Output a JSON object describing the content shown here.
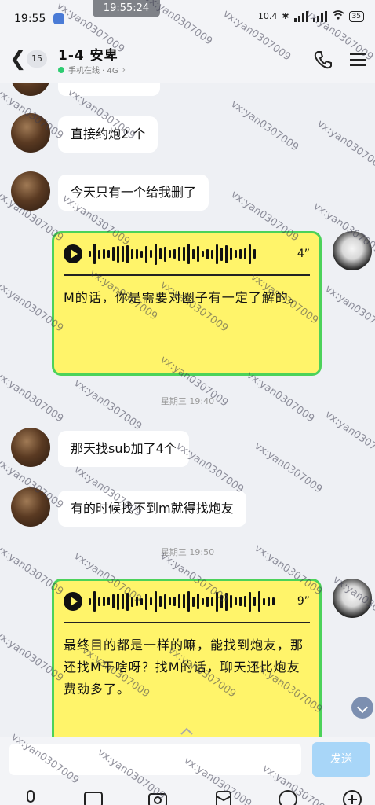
{
  "status_bar": {
    "time": "19:55",
    "overlay_time": "19:55:24",
    "network": "10.4",
    "battery": "35"
  },
  "header": {
    "unread_count": "15",
    "title": "1-4 安卑",
    "subtitle": "手机在线 · 4G"
  },
  "messages": [
    {
      "side": "left",
      "text": "直接约炮2 个"
    },
    {
      "side": "left",
      "text": "今天只有一个给我删了"
    },
    {
      "side": "right",
      "type": "voice",
      "duration": "4”",
      "transcript": "M的话，你是需要对圈子有一定了解的。"
    },
    {
      "type": "timestamp",
      "text": "星期三 19:40"
    },
    {
      "side": "left",
      "text": "那天找sub加了4个"
    },
    {
      "side": "left",
      "text": "有的时候找不到m就得找炮友"
    },
    {
      "type": "timestamp",
      "text": "星期三 19:50"
    },
    {
      "side": "right",
      "type": "voice",
      "duration": "9”",
      "transcript": "最终目的都是一样的嘛，能找到炮友，那还找M干啥呀？找M的话，聊天还比炮友费劲多了。"
    }
  ],
  "input": {
    "send_label": "发送"
  },
  "watermark": "vx:yan0307009",
  "colors": {
    "voice_bubble": "#fff46a",
    "voice_border": "#4cd25a",
    "send_button": "#a8d6f8",
    "online": "#2ecc71"
  }
}
